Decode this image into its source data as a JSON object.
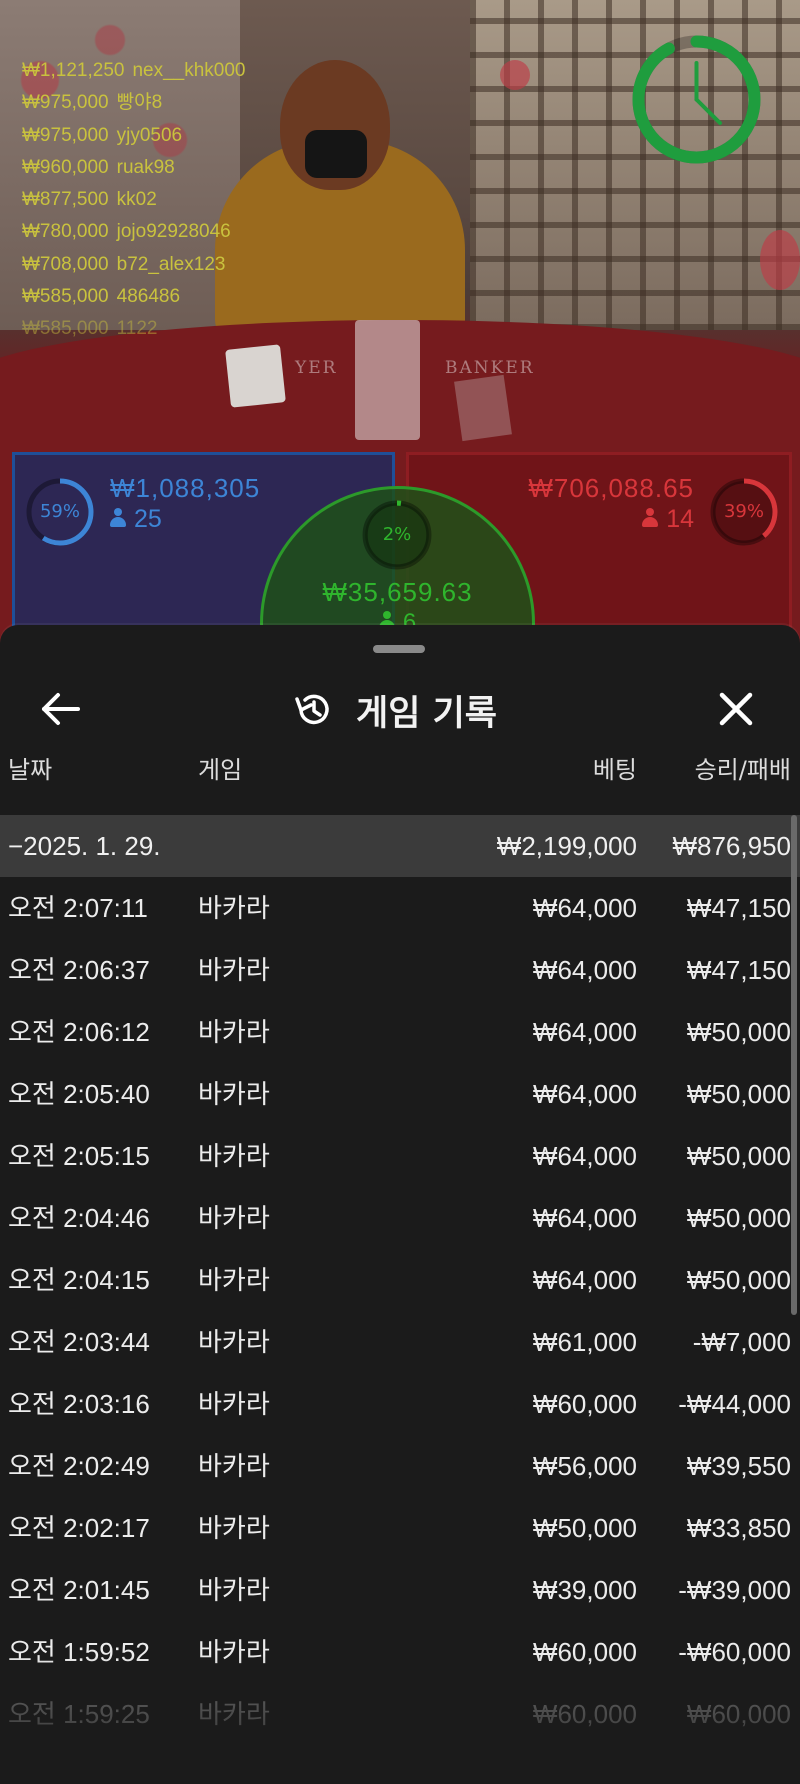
{
  "leaderboard": [
    {
      "amount": "₩1,121,250",
      "user": "nex__khk000"
    },
    {
      "amount": "₩975,000",
      "user": "빵야8"
    },
    {
      "amount": "₩975,000",
      "user": "yjy0506"
    },
    {
      "amount": "₩960,000",
      "user": "ruak98"
    },
    {
      "amount": "₩877,500",
      "user": "kk02"
    },
    {
      "amount": "₩780,000",
      "user": "jojo92928046"
    },
    {
      "amount": "₩708,000",
      "user": "b72_alex123"
    },
    {
      "amount": "₩585,000",
      "user": "486486"
    },
    {
      "amount": "₩585,000",
      "user": "1122"
    }
  ],
  "table_print": {
    "player": "YER",
    "banker": "BANKER"
  },
  "bets": {
    "player": {
      "percent": "59%",
      "percent_value": 59,
      "amount": "₩1,088,305",
      "players": "25",
      "color": "#3d85d6"
    },
    "banker": {
      "percent": "39%",
      "percent_value": 39,
      "amount": "₩706,088.65",
      "players": "14",
      "color": "#d8363b"
    },
    "tie": {
      "percent": "2%",
      "percent_value": 2,
      "amount": "₩35,659.63",
      "players": "6",
      "color": "#2fb52d"
    }
  },
  "timer": {
    "icon": "timer-clock-icon",
    "color": "#1f9d3e",
    "remaining_fraction": 0.92
  },
  "sheet": {
    "title": "게임 기록",
    "back_icon": "arrow-left-icon",
    "title_icon": "history-icon",
    "close_icon": "close-icon",
    "columns": {
      "date": "날짜",
      "game": "게임",
      "bet": "베팅",
      "result": "승리/패배"
    },
    "date_group": {
      "label": "−2025. 1. 29.",
      "bet": "₩2,199,000",
      "result": "₩876,950"
    },
    "rows": [
      {
        "time": "오전 2:07:11",
        "game": "바카라",
        "bet": "₩64,000",
        "result": "₩47,150"
      },
      {
        "time": "오전 2:06:37",
        "game": "바카라",
        "bet": "₩64,000",
        "result": "₩47,150"
      },
      {
        "time": "오전 2:06:12",
        "game": "바카라",
        "bet": "₩64,000",
        "result": "₩50,000"
      },
      {
        "time": "오전 2:05:40",
        "game": "바카라",
        "bet": "₩64,000",
        "result": "₩50,000"
      },
      {
        "time": "오전 2:05:15",
        "game": "바카라",
        "bet": "₩64,000",
        "result": "₩50,000"
      },
      {
        "time": "오전 2:04:46",
        "game": "바카라",
        "bet": "₩64,000",
        "result": "₩50,000"
      },
      {
        "time": "오전 2:04:15",
        "game": "바카라",
        "bet": "₩64,000",
        "result": "₩50,000"
      },
      {
        "time": "오전 2:03:44",
        "game": "바카라",
        "bet": "₩61,000",
        "result": "-₩7,000"
      },
      {
        "time": "오전 2:03:16",
        "game": "바카라",
        "bet": "₩60,000",
        "result": "-₩44,000"
      },
      {
        "time": "오전 2:02:49",
        "game": "바카라",
        "bet": "₩56,000",
        "result": "₩39,550"
      },
      {
        "time": "오전 2:02:17",
        "game": "바카라",
        "bet": "₩50,000",
        "result": "₩33,850"
      },
      {
        "time": "오전 2:01:45",
        "game": "바카라",
        "bet": "₩39,000",
        "result": "-₩39,000"
      },
      {
        "time": "오전 1:59:52",
        "game": "바카라",
        "bet": "₩60,000",
        "result": "-₩60,000"
      },
      {
        "time": "오전 1:59:25",
        "game": "바카라",
        "bet": "₩60,000",
        "result": "₩60,000"
      }
    ]
  }
}
